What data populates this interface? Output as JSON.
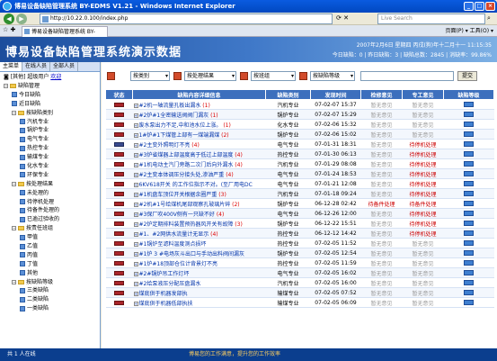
{
  "browser": {
    "title": "博易设备缺陷管理系统 BY-EDMS V1.21 - Windows Internet Explorer",
    "url": "http://10.22.0.100/index.php",
    "search_placeholder": "Live Search",
    "tab": "博易设备缺陷管理系统 BY-EDMS V1.21",
    "tools": "页面(P) ▾  工具(O) ▾"
  },
  "banner": {
    "title": "博易设备缺陷管理系统演示数据",
    "date_line": "2007年2月6日 星期四 丙戌(狗)年十二月十一   11:15:35",
    "stats_line": "今日缺陷：0 | 昨日缺陷：3 | 缺陷总数：2845 | 消缺率：99.86%"
  },
  "left": {
    "tabs": [
      "主菜单",
      "在线人员",
      "全部人员"
    ],
    "user_prefix": "[其他] 超级用户",
    "user_link": "欢迎",
    "tree": [
      {
        "label": "缺陷管理",
        "level": 0,
        "kind": "folder"
      },
      {
        "label": "今日缺陷",
        "level": 1,
        "kind": "doc"
      },
      {
        "label": "近日缺陷",
        "level": 1,
        "kind": "doc"
      },
      {
        "label": "按缺陷类别",
        "level": 1,
        "kind": "folder"
      },
      {
        "label": "汽机专业",
        "level": 2,
        "kind": "doc"
      },
      {
        "label": "锅炉专业",
        "level": 2,
        "kind": "doc"
      },
      {
        "label": "电气专业",
        "level": 2,
        "kind": "doc"
      },
      {
        "label": "热控专业",
        "level": 2,
        "kind": "doc"
      },
      {
        "label": "输煤专业",
        "level": 2,
        "kind": "doc"
      },
      {
        "label": "化水专业",
        "level": 2,
        "kind": "doc"
      },
      {
        "label": "环保专业",
        "level": 2,
        "kind": "doc"
      },
      {
        "label": "按处理结果",
        "level": 1,
        "kind": "folder"
      },
      {
        "label": "未处理的",
        "level": 2,
        "kind": "doc"
      },
      {
        "label": "待停机处理",
        "level": 2,
        "kind": "doc"
      },
      {
        "label": "待备件处理的",
        "level": 2,
        "kind": "doc"
      },
      {
        "label": "已逾过验收的",
        "level": 2,
        "kind": "doc"
      },
      {
        "label": "按责任班组",
        "level": 1,
        "kind": "folder"
      },
      {
        "label": "甲值",
        "level": 2,
        "kind": "doc"
      },
      {
        "label": "乙值",
        "level": 2,
        "kind": "doc"
      },
      {
        "label": "丙值",
        "level": 2,
        "kind": "doc"
      },
      {
        "label": "丁值",
        "level": 2,
        "kind": "doc"
      },
      {
        "label": "其他",
        "level": 2,
        "kind": "doc"
      },
      {
        "label": "按缺陷等级",
        "level": 1,
        "kind": "folder"
      },
      {
        "label": "三类缺陷",
        "level": 2,
        "kind": "doc"
      },
      {
        "label": "二类缺陷",
        "level": 2,
        "kind": "doc"
      },
      {
        "label": "一类缺陷",
        "level": 2,
        "kind": "doc"
      }
    ]
  },
  "filter": {
    "sel1": "按类别",
    "sel2": "按处理结果",
    "sel3": "按班组",
    "sel4": "按缺陷等级",
    "submit": "提交"
  },
  "table": {
    "headers": [
      "状态",
      "缺陷内容详细信息",
      "缺陷类别",
      "发现时间",
      "检修意见",
      "专工意见",
      "缺陷等级"
    ],
    "rows": [
      {
        "c": "r",
        "t": "#2机一轴流量孔板出漏水",
        "n": "(1)",
        "cat": "汽机专业",
        "time": "07-02-07 15:37",
        "r": "暂无意见",
        "e": "暂无意见",
        "ec": "gray"
      },
      {
        "c": "r",
        "t": "#2炉#1全密输送阀阀门漏灰",
        "n": "(1)",
        "cat": "锅炉专业",
        "time": "07-02-07 15:29",
        "r": "暂无意见",
        "e": "暂无意见",
        "ec": "gray"
      },
      {
        "c": "r",
        "t": "废水泵出力不足,中和池水位上涨。",
        "n": "(1)",
        "cat": "化水专业",
        "time": "07-02-06 15:32",
        "r": "暂无意见",
        "e": "暂无意见",
        "ec": "gray"
      },
      {
        "c": "r",
        "t": "1#炉#1下煤管上部有一煤端漏煤",
        "n": "(2)",
        "cat": "锅炉专业",
        "time": "07-02-06 15:02",
        "r": "暂无意见",
        "e": "暂无意见",
        "ec": "gray"
      },
      {
        "c": "b",
        "t": "#2主变外照明灯不亮",
        "n": "(4)",
        "cat": "电气专业",
        "time": "07-01-31 18:31",
        "r": "暂无意见",
        "e": "待停机处理",
        "ec": "red"
      },
      {
        "c": "r",
        "t": "#3炉省煤器上部温度高于低过上部温度",
        "n": "(4)",
        "cat": "热控专业",
        "time": "07-01-30 06:13",
        "r": "暂无意见",
        "e": "待停机处理",
        "ec": "red"
      },
      {
        "c": "r",
        "t": "#1机电动主汽门旁路二次门后向外漏水",
        "n": "(4)",
        "cat": "汽机专业",
        "time": "07-01-29 08:08",
        "r": "暂无意见",
        "e": "待停机处理",
        "ec": "red"
      },
      {
        "c": "r",
        "t": "#2主变本体调压分接头处,渗油严重",
        "n": "(4)",
        "cat": "电气专业",
        "time": "07-01-24 18:53",
        "r": "暂无意见",
        "e": "待停机处理",
        "ec": "red"
      },
      {
        "c": "r",
        "t": "6KV618开关 的工作位指示不对。(至厂用电DC",
        "n": "",
        "cat": "电气专业",
        "time": "07-01-21 12:08",
        "r": "暂无意见",
        "e": "待停机处理",
        "ec": "red"
      },
      {
        "c": "r",
        "t": "#1机盘车顶位开关根据余圈严重",
        "n": "(3)",
        "cat": "汽机专业",
        "time": "07-01-18 09:24",
        "r": "暂无意见",
        "e": "待停机处理",
        "ec": "red"
      },
      {
        "c": "r",
        "t": "#2机#1号给煤机尾部观察孔玻璃片碎",
        "n": "(2)",
        "cat": "锅炉专业",
        "time": "06-12-28 02:42",
        "r": "待备件处理",
        "e": "待备件处理",
        "ec": "red"
      },
      {
        "c": "r",
        "t": "#3保厂吹400V侧有一只缺不好",
        "n": "(4)",
        "cat": "电气专业",
        "time": "06-12-26 12:00",
        "r": "暂无意见",
        "e": "待停机处理",
        "ec": "red"
      },
      {
        "c": "r",
        "t": "#2炉定期排料装置预热器风开关有故障",
        "n": "(3)",
        "cat": "锅炉专业",
        "time": "06-12-22 15:51",
        "r": "暂无意见",
        "e": "待停机处理",
        "ec": "red"
      },
      {
        "c": "r",
        "t": "#1、#2网供水流量计无显示",
        "n": "(4)",
        "cat": "热控专业",
        "time": "06-12-12 14:42",
        "r": "暂无意见",
        "e": "待停机处理",
        "ec": "red"
      },
      {
        "c": "r",
        "t": "#1锅炉至滤料温度测点损坏",
        "n": "",
        "cat": "热控专业",
        "time": "07-02-05 11:52",
        "r": "暂无意见",
        "e": "暂无意见",
        "ec": "gray"
      },
      {
        "c": "r",
        "t": "#1炉 3 #电场灰斗出口与手动出料阀间漏灰",
        "n": "",
        "cat": "锅炉专业",
        "time": "07-02-05 12:54",
        "r": "暂无意见",
        "e": "暂无意见",
        "ec": "gray"
      },
      {
        "c": "r",
        "t": "#1炉#18顶部仓位计背景灯不亮",
        "n": "",
        "cat": "热控专业",
        "time": "07-02-05 11:59",
        "r": "暂无意见",
        "e": "暂无意见",
        "ec": "gray"
      },
      {
        "c": "r",
        "t": "#2#锅炉吊工作灯坏",
        "n": "",
        "cat": "电气专业",
        "time": "07-02-05 16:02",
        "r": "暂无意见",
        "e": "暂无意见",
        "ec": "gray"
      },
      {
        "c": "r",
        "t": "#2给泵液压分配压盘漏水",
        "n": "",
        "cat": "汽机专业",
        "time": "07-02-05 16:00",
        "r": "暂无意见",
        "e": "暂无意见",
        "ec": "gray"
      },
      {
        "c": "r",
        "t": "煤底供于机器发部执",
        "n": "",
        "cat": "输煤专业",
        "time": "07-02-05 07:52",
        "r": "暂无意见",
        "e": "暂无意见",
        "ec": "gray"
      },
      {
        "c": "r",
        "t": "煤底供于机器低部执扶",
        "n": "",
        "cat": "输煤专业",
        "time": "07-02-05 06:09",
        "r": "暂无意见",
        "e": "暂无意见",
        "ec": "gray"
      }
    ]
  },
  "status": {
    "left": "共 1 人在线",
    "center": "博易您的工作满意，提升您的工作效率"
  }
}
